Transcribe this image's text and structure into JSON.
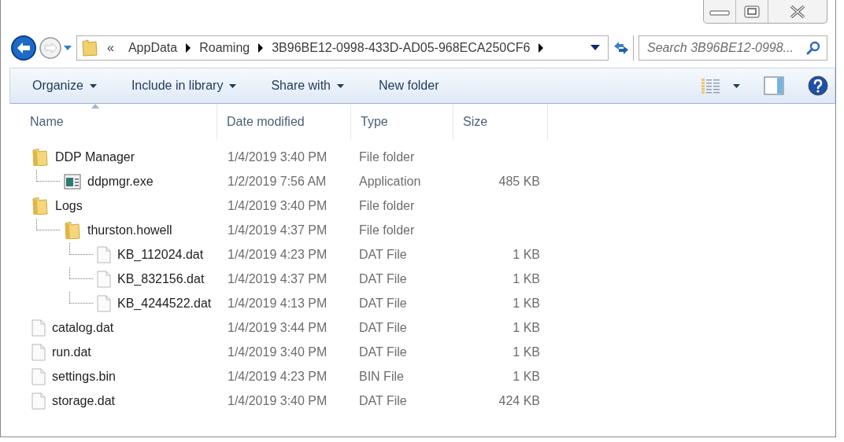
{
  "window": {
    "controls": [
      {
        "kind": "minimize"
      },
      {
        "kind": "maximize"
      },
      {
        "kind": "close"
      }
    ]
  },
  "address": {
    "overflow": "«",
    "crumbs": [
      "AppData",
      "Roaming",
      "3B96BE12-0998-433D-AD05-968ECA250CF6"
    ]
  },
  "search": {
    "placeholder": "Search 3B96BE12-0998..."
  },
  "toolbar": {
    "buttons": [
      {
        "label": "Organize",
        "dropdown": true
      },
      {
        "label": "Include in library",
        "dropdown": true
      },
      {
        "label": "Share with",
        "dropdown": true
      },
      {
        "label": "New folder",
        "dropdown": false
      }
    ]
  },
  "columns": [
    "Name",
    "Date modified",
    "Type",
    "Size"
  ],
  "files": [
    {
      "kind": "folder",
      "name": "DDP Manager",
      "date": "1/4/2019 3:40 PM",
      "type": "File folder",
      "children": [
        {
          "kind": "exe",
          "name": "ddpmgr.exe",
          "date": "1/2/2019 7:56 AM",
          "type": "Application",
          "size": "485 KB"
        }
      ]
    },
    {
      "kind": "folder",
      "name": "Logs",
      "date": "1/4/2019 3:40 PM",
      "type": "File folder",
      "children": [
        {
          "kind": "folder",
          "name": "thurston.howell",
          "date": "1/4/2019 4:37 PM",
          "type": "File folder",
          "children": [
            {
              "kind": "file",
              "name": "KB_112024.dat",
              "date": "1/4/2019 4:23 PM",
              "type": "DAT File",
              "size": "1 KB"
            },
            {
              "kind": "file",
              "name": "KB_832156.dat",
              "date": "1/4/2019 4:37 PM",
              "type": "DAT File",
              "size": "1 KB"
            },
            {
              "kind": "file",
              "name": "KB_4244522.dat",
              "date": "1/4/2019 4:13 PM",
              "type": "DAT File",
              "size": "1 KB"
            }
          ]
        }
      ]
    },
    {
      "kind": "file",
      "name": "catalog.dat",
      "date": "1/4/2019 3:44 PM",
      "type": "DAT File",
      "size": "1 KB"
    },
    {
      "kind": "file",
      "name": "run.dat",
      "date": "1/4/2019 3:40 PM",
      "type": "DAT File",
      "size": "1 KB"
    },
    {
      "kind": "file",
      "name": "settings.bin",
      "date": "1/4/2019 4:23 PM",
      "type": "BIN File",
      "size": "1 KB"
    },
    {
      "kind": "file",
      "name": "storage.dat",
      "date": "1/4/2019 3:40 PM",
      "type": "DAT File",
      "size": "424 KB"
    }
  ]
}
